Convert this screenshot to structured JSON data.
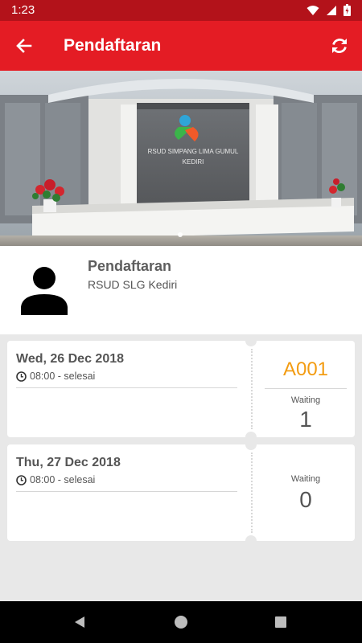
{
  "status_bar": {
    "time": "1:23"
  },
  "app_bar": {
    "title": "Pendaftaran",
    "back_icon": "arrow-left-icon",
    "refresh_icon": "refresh-icon"
  },
  "hero": {
    "building_sign_line1": "RSUD SIMPANG LIMA GUMUL",
    "building_sign_line2": "KEDIRI",
    "active_slide": 1
  },
  "profile": {
    "name": "Pendaftaran",
    "subtitle": "RSUD SLG Kediri",
    "avatar_icon": "person-icon"
  },
  "schedules": [
    {
      "date": "Wed, 26 Dec 2018",
      "time": "08:00 - selesai",
      "queue_number": "A001",
      "waiting_label": "Waiting",
      "waiting_count": "1"
    },
    {
      "date": "Thu, 27 Dec 2018",
      "time": "08:00 - selesai",
      "waiting_label": "Waiting",
      "waiting_count": "0"
    }
  ],
  "colors": {
    "primary": "#e41c24",
    "status_bar": "#b3121a",
    "accent": "#f39c12",
    "background": "#e8e8e8"
  }
}
